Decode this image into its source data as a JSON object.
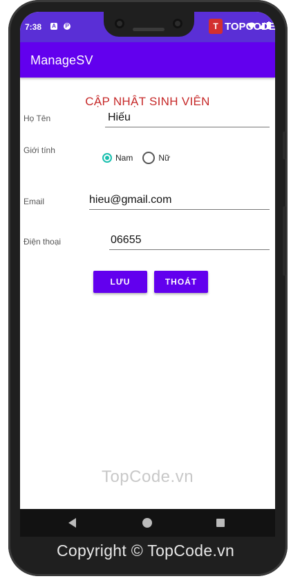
{
  "status_bar": {
    "time": "7:38",
    "icon_a": "A",
    "icon_p": "P"
  },
  "logo": {
    "mark": "T",
    "text": "TOPCODE.VN"
  },
  "app_bar": {
    "title": "ManageSV"
  },
  "form": {
    "title": "CẬP NHẬT SINH VIÊN",
    "name_label": "Họ Tên",
    "name_value": "Hiếu",
    "gender_label": "Giới tính",
    "gender_options": [
      "Nam",
      "Nữ"
    ],
    "gender_selected": "Nam",
    "email_label": "Email",
    "email_value": "hieu@gmail.com",
    "phone_label": "Điện thoại",
    "phone_value": "06655",
    "save_label": "LƯU",
    "exit_label": "THOÁT"
  },
  "watermark": "TopCode.vn",
  "copyright": "Copyright © TopCode.vn",
  "colors": {
    "accent": "#6200ee",
    "status": "#5a2fd6",
    "title": "#c62828",
    "radio": "#19bfae"
  }
}
